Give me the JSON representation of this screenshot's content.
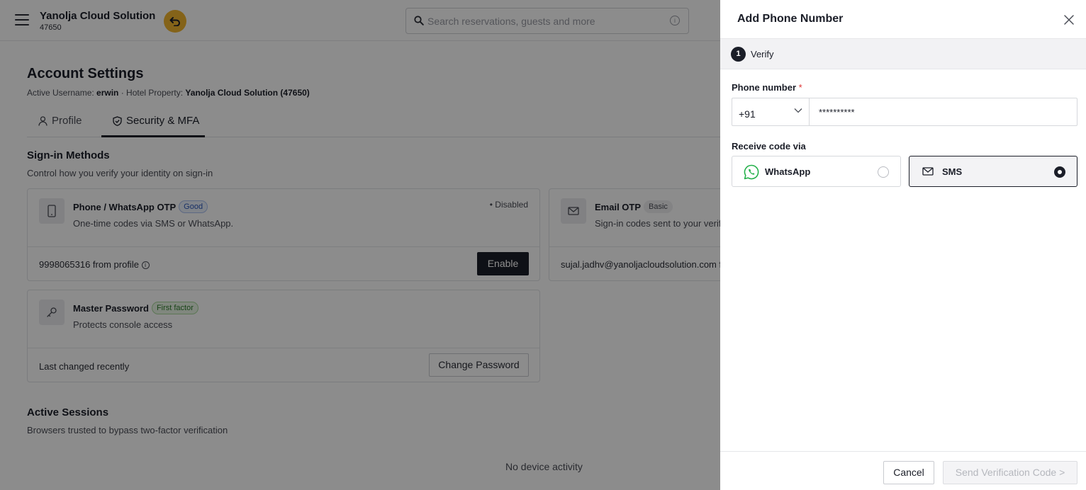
{
  "header": {
    "brand_title": "Yanolja Cloud Solution",
    "brand_sub": "47650",
    "search_placeholder": "Search reservations, guests and more",
    "accent_color": "#f0b52e"
  },
  "page": {
    "title": "Account Settings",
    "subtitle_prefix": "Active Username: ",
    "username": "erwin",
    "subtitle_mid": " · Hotel Property: ",
    "property": "Yanolja Cloud Solution (47650)",
    "tabs": [
      {
        "label": "Profile",
        "icon": "user-icon"
      },
      {
        "label": "Security & MFA",
        "icon": "shield-check-icon",
        "active": true
      }
    ]
  },
  "signin": {
    "title": "Sign-in Methods",
    "subtitle": "Control how you verify your identity on sign-in",
    "phone": {
      "title": "Phone / WhatsApp OTP",
      "badge": "Good",
      "description": "One-time codes via SMS or WhatsApp.",
      "status": "• Disabled",
      "footer": "9998065316 from profile",
      "button": "Enable"
    },
    "email": {
      "title": "Email OTP",
      "badge": "Basic",
      "description": "Sign-in codes sent to your verified email.",
      "footer": "sujal.jadhv@yanoljacloudsolution.com from profile"
    },
    "password": {
      "title": "Master Password",
      "badge": "First factor",
      "description": "Protects console access",
      "footer": "Last changed recently",
      "button": "Change Password"
    }
  },
  "sessions": {
    "title": "Active Sessions",
    "subtitle": "Browsers trusted to bypass two-factor verification",
    "empty": "No device activity"
  },
  "drawer": {
    "title": "Add Phone Number",
    "step_number": "1",
    "step_label": "Verify",
    "phone_label": "Phone number",
    "required_mark": "*",
    "country_code": "+91",
    "phone_value": "**********",
    "receive_label": "Receive code via",
    "options": [
      {
        "label": "WhatsApp",
        "icon": "whatsapp-icon",
        "selected": false
      },
      {
        "label": "SMS",
        "icon": "mail-icon",
        "selected": true
      }
    ],
    "cancel": "Cancel",
    "send": "Send Verification Code >"
  }
}
